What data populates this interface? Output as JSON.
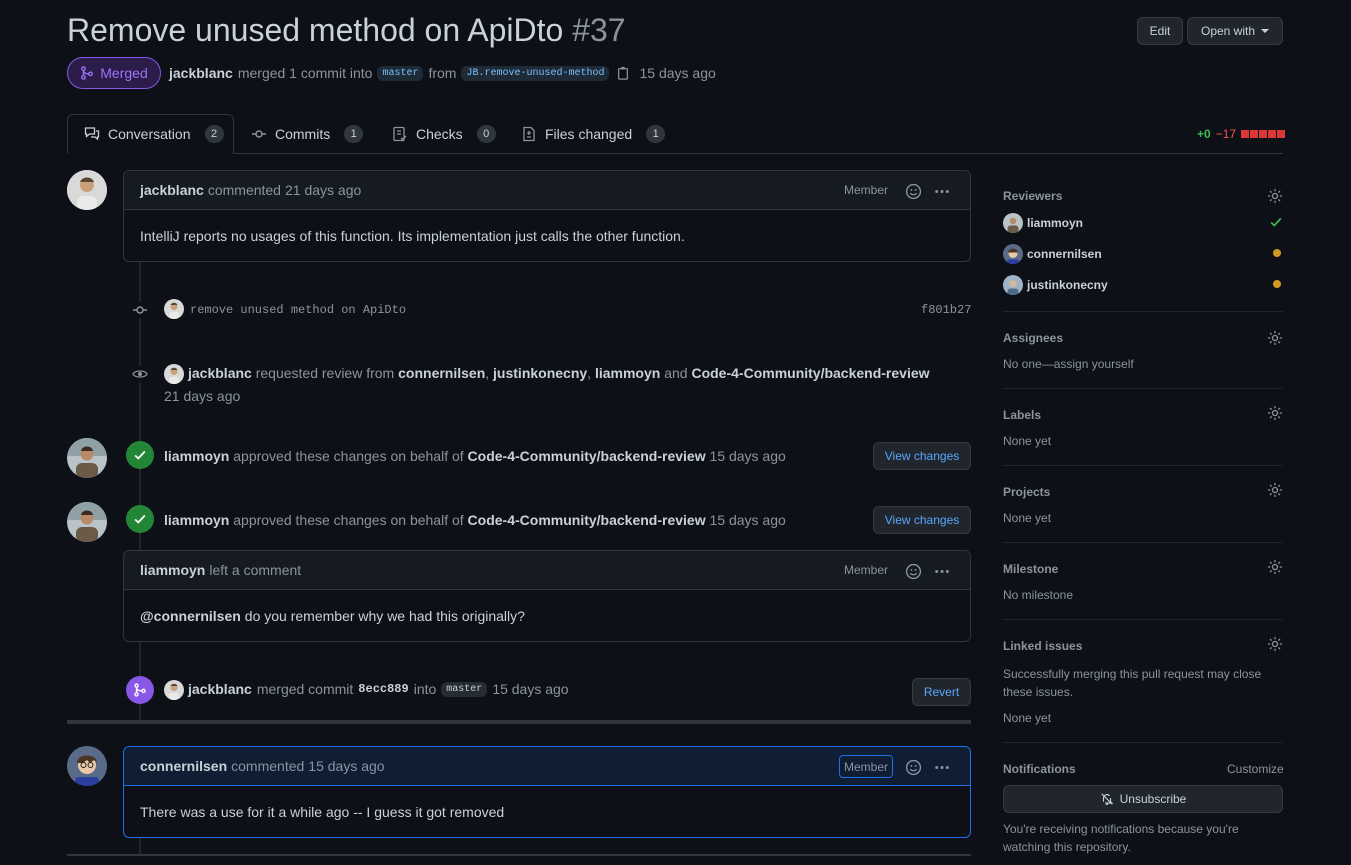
{
  "pr": {
    "title": "Remove unused method on ApiDto",
    "number": "#37",
    "state": "Merged",
    "author": "jackblanc",
    "merge_text": "merged 1 commit into",
    "base": "master",
    "from_text": "from",
    "head": "JB.remove-unused-method",
    "time": "15 days ago"
  },
  "header_buttons": {
    "edit": "Edit",
    "open_with": "Open with"
  },
  "tabs": [
    {
      "label": "Conversation",
      "count": "2"
    },
    {
      "label": "Commits",
      "count": "1"
    },
    {
      "label": "Checks",
      "count": "0"
    },
    {
      "label": "Files changed",
      "count": "1"
    }
  ],
  "diffstat": {
    "add": "+0",
    "del": "−17"
  },
  "timeline": {
    "comment1": {
      "author": "jackblanc",
      "action": "commented",
      "time": "21 days ago",
      "role": "Member",
      "body": "IntelliJ reports no usages of this function. Its implementation just calls the other function."
    },
    "commit": {
      "message": "remove unused method on ApiDto",
      "sha": "f801b27"
    },
    "review_request": {
      "author": "jackblanc",
      "text": "requested review from",
      "r1": "connernilsen",
      "r2": "justinkonecny",
      "r3": "liammoyn",
      "and": "and",
      "team": "Code-4-Community/backend-review",
      "time": "21 days ago"
    },
    "approval1": {
      "author": "liammoyn",
      "text": "approved these changes on behalf of",
      "team": "Code-4-Community/backend-review",
      "time": "15 days ago",
      "button": "View changes"
    },
    "approval2": {
      "author": "liammoyn",
      "text": "approved these changes on behalf of",
      "team": "Code-4-Community/backend-review",
      "time": "15 days ago",
      "button": "View changes"
    },
    "comment2": {
      "author": "liammoyn",
      "action": "left a comment",
      "role": "Member",
      "mention": "@connernilsen",
      "body": "do you remember why we had this originally?"
    },
    "merge": {
      "author": "jackblanc",
      "text": "merged commit",
      "sha": "8ecc889",
      "into": "into",
      "branch": "master",
      "time": "15 days ago",
      "button": "Revert"
    },
    "comment3": {
      "author": "connernilsen",
      "action": "commented",
      "time": "15 days ago",
      "role": "Member",
      "body": "There was a use for it a while ago -- I guess it got removed"
    }
  },
  "sidebar": {
    "reviewers_title": "Reviewers",
    "reviewers": [
      {
        "name": "liammoyn",
        "status": "approved"
      },
      {
        "name": "connernilsen",
        "status": "pending"
      },
      {
        "name": "justinkonecny",
        "status": "pending"
      }
    ],
    "assignees_title": "Assignees",
    "assignees_text": "No one—assign yourself",
    "labels_title": "Labels",
    "labels_text": "None yet",
    "projects_title": "Projects",
    "projects_text": "None yet",
    "milestone_title": "Milestone",
    "milestone_text": "No milestone",
    "linked_title": "Linked issues",
    "linked_desc": "Successfully merging this pull request may close these issues.",
    "linked_text": "None yet",
    "notifications_title": "Notifications",
    "customize": "Customize",
    "unsubscribe": "Unsubscribe",
    "notif_desc": "You're receiving notifications because you're watching this repository."
  },
  "colors": {
    "merged": "#a371f7",
    "approved": "#238636",
    "add": "#3fb950",
    "del": "#f85149",
    "pending": "#d29922"
  }
}
